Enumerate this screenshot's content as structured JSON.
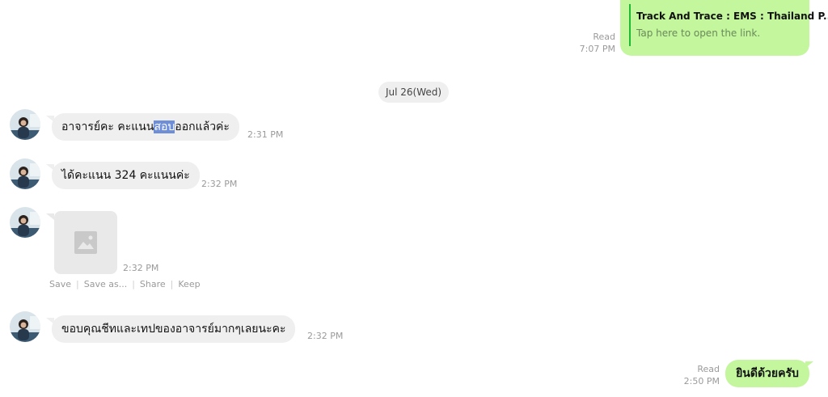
{
  "link_message": {
    "title": "Track And Trace : EMS : Thailand P...",
    "subtitle": "Tap here to open the link.",
    "status": "Read",
    "time": "7:07 PM"
  },
  "date_separator": "Jul 26(Wed)",
  "messages": [
    {
      "text_before": "อาจารย์คะ คะแนน",
      "text_highlight": "สอบ",
      "text_after": "ออกแล้วค่ะ",
      "time": "2:31 PM"
    },
    {
      "text": "ได้คะแนน 324 คะแนนค่ะ",
      "time": "2:32 PM"
    },
    {
      "type": "image",
      "icon": "image-placeholder-icon",
      "time": "2:32 PM"
    },
    {
      "text": "ขอบคุณชีทและเทปของอาจารย์มากๆเลยนะคะ",
      "time": "2:32 PM"
    }
  ],
  "image_actions": {
    "save": "Save",
    "save_as": "Save as...",
    "share": "Share",
    "keep": "Keep"
  },
  "reply": {
    "text": "ยินดีด้วยครับ",
    "status": "Read",
    "time": "2:50 PM"
  },
  "colors": {
    "outgoing": "#c3f69d",
    "incoming": "#efefef",
    "link_bar": "#1fb834",
    "highlight": "#6f8ed8"
  }
}
